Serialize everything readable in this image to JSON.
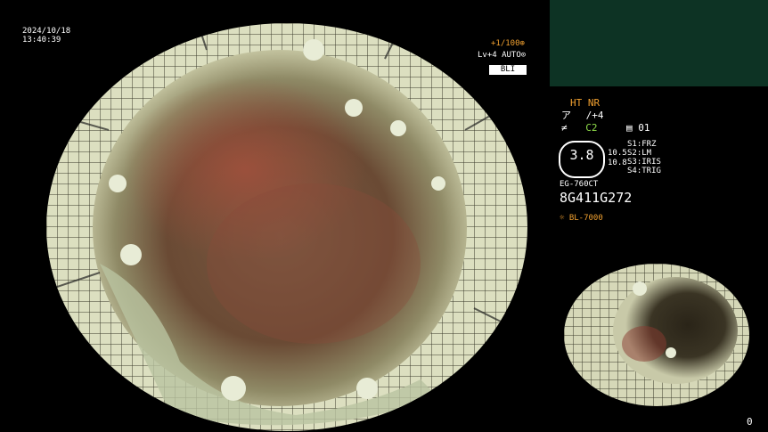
{
  "datetime": {
    "date": "2024/10/18",
    "time": "13:40:39"
  },
  "overlay": {
    "zoom": "+1/100",
    "zoom_icon": "zoom-icon",
    "level": "Lv+4 AUTO",
    "auto_icon": "auto-icon",
    "mode_badge": "BLI"
  },
  "settings": {
    "ht_nr": "HT NR",
    "row1_icon": "enhancement-icon",
    "row1_value": "/+4",
    "row2_icon": "color-icon",
    "row2_value": "C2",
    "film_icon": "film-icon",
    "film_value": "01",
    "display_big": "3.8",
    "values": [
      "10.5",
      "10.8"
    ],
    "switches": [
      "S1:FRZ",
      "S2:LM",
      "S3:IRIS",
      "S4:TRIG"
    ],
    "scope_model": "EG-760CT",
    "serial": "8G411G272",
    "light_icon": "light-source-icon",
    "light_source": "BL-7000"
  },
  "footer": {
    "counter": "0"
  },
  "colors": {
    "accent_orange": "#f0a030",
    "accent_green": "#8fdc4a",
    "panel_green": "#0d3324"
  }
}
